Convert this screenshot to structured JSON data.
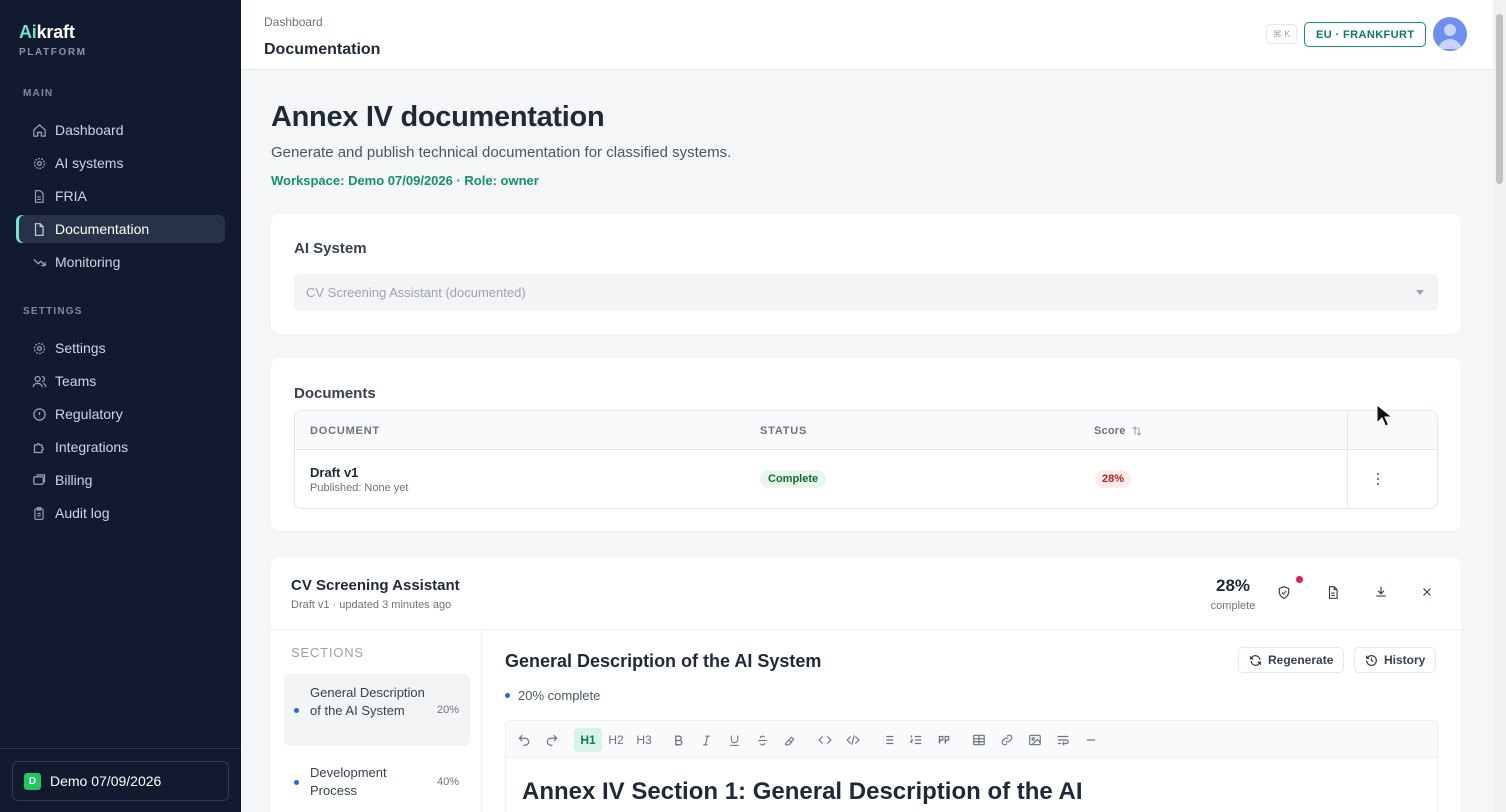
{
  "brand": {
    "name_prefix": "Ai",
    "name_suffix": "kraft",
    "subtitle": "PLATFORM"
  },
  "sidebar": {
    "main_label": "MAIN",
    "main_items": [
      {
        "label": "Dashboard",
        "icon": "home-icon"
      },
      {
        "label": "AI systems",
        "icon": "gear-icon"
      },
      {
        "label": "FRIA",
        "icon": "file-icon"
      },
      {
        "label": "Documentation",
        "icon": "document-icon",
        "active": true
      },
      {
        "label": "Monitoring",
        "icon": "trend-down-icon"
      }
    ],
    "settings_label": "SETTINGS",
    "settings_items": [
      {
        "label": "Settings",
        "icon": "gear-icon"
      },
      {
        "label": "Teams",
        "icon": "users-icon"
      },
      {
        "label": "Regulatory",
        "icon": "alert-circle-icon"
      },
      {
        "label": "Integrations",
        "icon": "puzzle-icon"
      },
      {
        "label": "Billing",
        "icon": "billing-icon"
      },
      {
        "label": "Audit log",
        "icon": "clipboard-icon"
      }
    ],
    "workspace": {
      "badge": "D",
      "name": "Demo 07/09/2026"
    }
  },
  "topbar": {
    "breadcrumb": "Dashboard",
    "title": "Documentation",
    "shortcut": "⌘ K",
    "region": "EU · FRANKFURT"
  },
  "page": {
    "title": "Annex IV documentation",
    "subtitle": "Generate and publish technical documentation for classified systems.",
    "meta": "Workspace: Demo 07/09/2026 · Role: owner"
  },
  "ai_system": {
    "label": "AI System",
    "selected": "CV Screening Assistant (documented)"
  },
  "documents": {
    "label": "Documents",
    "columns": [
      "DOCUMENT",
      "STATUS",
      "Score"
    ],
    "rows": [
      {
        "name": "Draft v1",
        "published": "Published: None yet",
        "status": "Complete",
        "score": "28%"
      }
    ]
  },
  "editor": {
    "system_name": "CV Screening Assistant",
    "version_info": "Draft v1 · updated 3 minutes ago",
    "percent": "28%",
    "percent_label": "complete",
    "sections_label": "SECTIONS",
    "sections": [
      {
        "title": "General Description of the AI System",
        "percent": "20%",
        "active": true
      },
      {
        "title": "Development Process",
        "percent": "40%"
      }
    ],
    "current_section_title": "General Description of the AI System",
    "current_section_progress": "20% complete",
    "regenerate_label": "Regenerate",
    "history_label": "History",
    "toolbar": {
      "h1": "H1",
      "h2": "H2",
      "h3": "H3"
    },
    "content_heading": "Annex IV Section 1: General Description of the AI"
  },
  "colors": {
    "sidebar_bg": "#111a2e",
    "accent": "#14916f",
    "accent_light": "#6ee7c8",
    "danger": "#e11d48"
  }
}
